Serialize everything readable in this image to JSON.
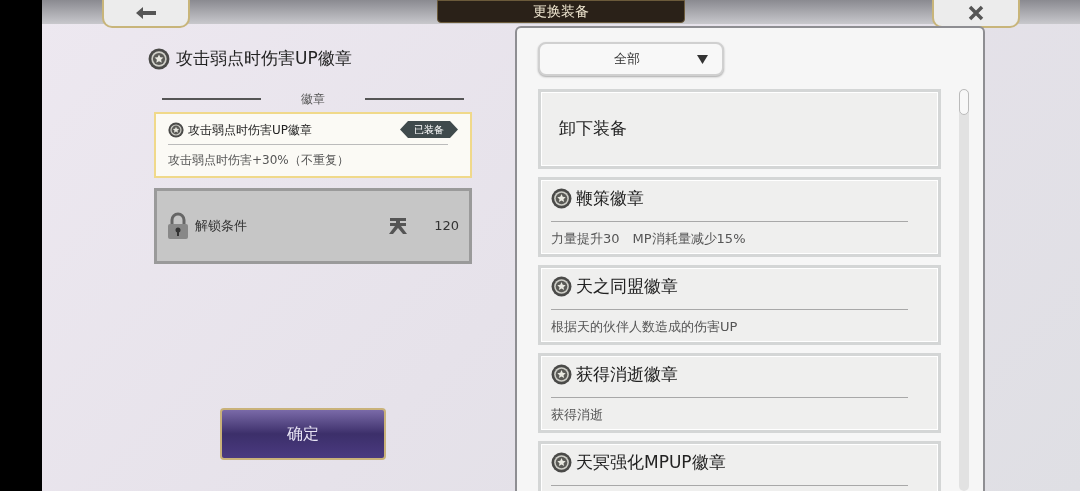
{
  "header": {
    "title": "更换装备"
  },
  "detail": {
    "name": "攻击弱点时伤害UP徽章",
    "section_label": "徽章",
    "slot": {
      "name": "攻击弱点时伤害UP徽章",
      "badge": "已装备",
      "description": "攻击弱点时伤害+30%（不重复）"
    },
    "unlock": {
      "label": "解锁条件",
      "value": "120"
    }
  },
  "confirm_button": "确定",
  "filter": {
    "value": "全部"
  },
  "list": [
    {
      "kind": "action",
      "title": "卸下装备"
    },
    {
      "kind": "badge",
      "title": "鞭策徽章",
      "description": "力量提升30　MP消耗量减少15%"
    },
    {
      "kind": "badge",
      "title": "天之同盟徽章",
      "description": "根据天的伙伴人数造成的伤害UP"
    },
    {
      "kind": "badge",
      "title": "获得消逝徽章",
      "description": "获得消逝"
    },
    {
      "kind": "badge",
      "title": "天冥强化MPUP徽章"
    }
  ]
}
